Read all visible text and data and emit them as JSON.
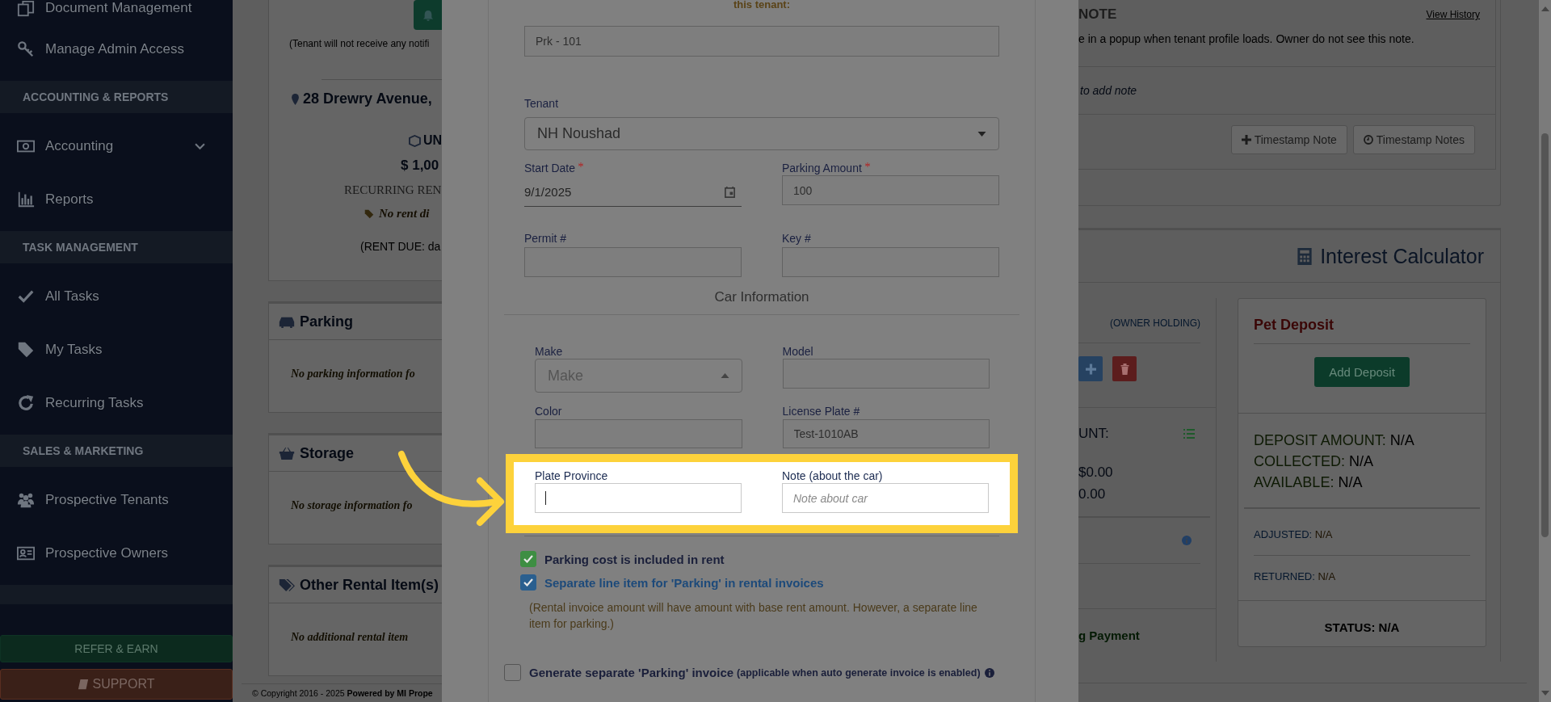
{
  "sidebar": {
    "items": [
      {
        "kind": "item",
        "label": "Document Management"
      },
      {
        "kind": "item",
        "label": "Manage Admin Access"
      },
      {
        "kind": "section",
        "label": "ACCOUNTING & REPORTS"
      },
      {
        "kind": "item",
        "label": "Accounting",
        "expandable": true
      },
      {
        "kind": "item",
        "label": "Reports"
      },
      {
        "kind": "section",
        "label": "TASK MANAGEMENT"
      },
      {
        "kind": "item",
        "label": "All Tasks"
      },
      {
        "kind": "item",
        "label": "My Tasks"
      },
      {
        "kind": "item",
        "label": "Recurring Tasks"
      },
      {
        "kind": "section",
        "label": "SALES & MARKETING"
      },
      {
        "kind": "item",
        "label": "Prospective Tenants"
      },
      {
        "kind": "item",
        "label": "Prospective Owners"
      },
      {
        "kind": "spacer"
      }
    ],
    "refer_button": "REFER & EARN",
    "support_button": "SUPPORT"
  },
  "property": {
    "notice": "(Tenant will not receive any notifi",
    "address": "28 Drewry Avenue,",
    "unit": "UN",
    "rent": "$ 1,00",
    "rent_label": "RECURRING REN",
    "discount": "No rent di",
    "rent_due": "(RENT DUE: da",
    "panels": [
      {
        "title": "Parking",
        "empty_text": "No parking information fo"
      },
      {
        "title": "Storage",
        "empty_text": "No storage information fo"
      },
      {
        "title": "Other Rental Item(s)",
        "empty_text": "No additional rental item"
      }
    ],
    "copyright": "© Copyright 2016 - 2025 **Powered by MI Prope**"
  },
  "modal": {
    "heading": "this tenant:",
    "parking_spot": "Prk - 101",
    "tenant": {
      "label": "Tenant",
      "value": "NH Noushad"
    },
    "start_date": {
      "label": "Start Date",
      "required": true,
      "value": "9/1/2025"
    },
    "parking_amount": {
      "label": "Parking Amount",
      "required": true,
      "value": "100"
    },
    "permit": {
      "label": "Permit #"
    },
    "key": {
      "label": "Key #"
    },
    "car_section": "Car Information",
    "make": {
      "label": "Make",
      "placeholder": "Make",
      "expanded": true
    },
    "model": {
      "label": "Model"
    },
    "color": {
      "label": "Color"
    },
    "license_plate": {
      "label": "License Plate #",
      "value": "Test-1010AB"
    },
    "plate_province": {
      "label": "Plate Province",
      "focused": true
    },
    "note": {
      "label": "Note (about the car)",
      "placeholder": "Note about car"
    },
    "checkboxes": [
      {
        "label": "Parking cost is included in rent",
        "checked": true,
        "color": "#3e8e43"
      },
      {
        "label": "Separate line item for 'Parking' in rental invoices",
        "checked": true,
        "color": "#2a5f8f"
      }
    ],
    "invoice_note": "(Rental invoice amount will have amount with base rent amount. However, a separate line item for parking.)",
    "generate_invoice": {
      "label": "Generate separate 'Parking' invoice",
      "note": "(applicable when auto generate invoice is enabled)",
      "checked": false
    }
  },
  "notes": {
    "title": "NOTE",
    "view_history": "View History",
    "description": "e in a popup when tenant profile loads. Owner do not see this note.",
    "add_hint": "to add note",
    "buttons": [
      "Timestamp Note",
      "Timestamp Notes"
    ]
  },
  "interest_calculator": "Interest Calculator",
  "holding": {
    "label": "(OWNER HOLDING)",
    "amount_label": "UNT:",
    "values": [
      "$0.00",
      "0.00"
    ],
    "link": "g Payment"
  },
  "pet_deposit": {
    "title": "Pet Deposit",
    "button": "Add Deposit",
    "stats": [
      {
        "label": "DEPOSIT AMOUNT:",
        "value": "N/A"
      },
      {
        "label": "COLLECTED:",
        "value": "N/A"
      },
      {
        "label": "AVAILABLE:",
        "value": "N/A"
      }
    ],
    "adjusted": {
      "label": "ADJUSTED:",
      "value": "N/A"
    },
    "returned": {
      "label": "RETURNED:",
      "value": "N/A"
    },
    "status": {
      "label": "STATUS:",
      "value": "N/A"
    }
  }
}
